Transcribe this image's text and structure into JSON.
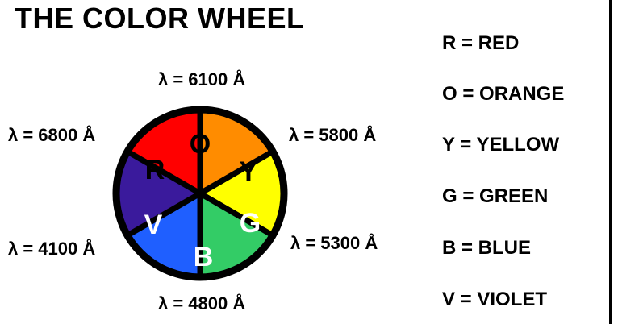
{
  "title": "THE COLOR WHEEL",
  "wavelength_labels": {
    "top": "λ = 6100 Å",
    "top_right": "λ = 5800 Å",
    "bottom_right": "λ = 5300 Å",
    "bottom": "λ = 4800 Å",
    "bottom_left": "λ = 4100 Å",
    "top_left": "λ = 6800 Å"
  },
  "segments": [
    {
      "letter": "R",
      "name": "red",
      "color": "#ff0000",
      "text_color": "#000000"
    },
    {
      "letter": "O",
      "name": "orange",
      "color": "#ff8c00",
      "text_color": "#000000"
    },
    {
      "letter": "Y",
      "name": "yellow",
      "color": "#ffff00",
      "text_color": "#000000"
    },
    {
      "letter": "G",
      "name": "green",
      "color": "#33cc66",
      "text_color": "#ffffff"
    },
    {
      "letter": "B",
      "name": "blue",
      "color": "#1f5fff",
      "text_color": "#ffffff"
    },
    {
      "letter": "V",
      "name": "violet",
      "color": "#3a1a9c",
      "text_color": "#ffffff"
    }
  ],
  "legend": [
    "R = RED",
    "O = ORANGE",
    "Y = YELLOW",
    "G = GREEN",
    "B = BLUE",
    "V = VIOLET"
  ]
}
